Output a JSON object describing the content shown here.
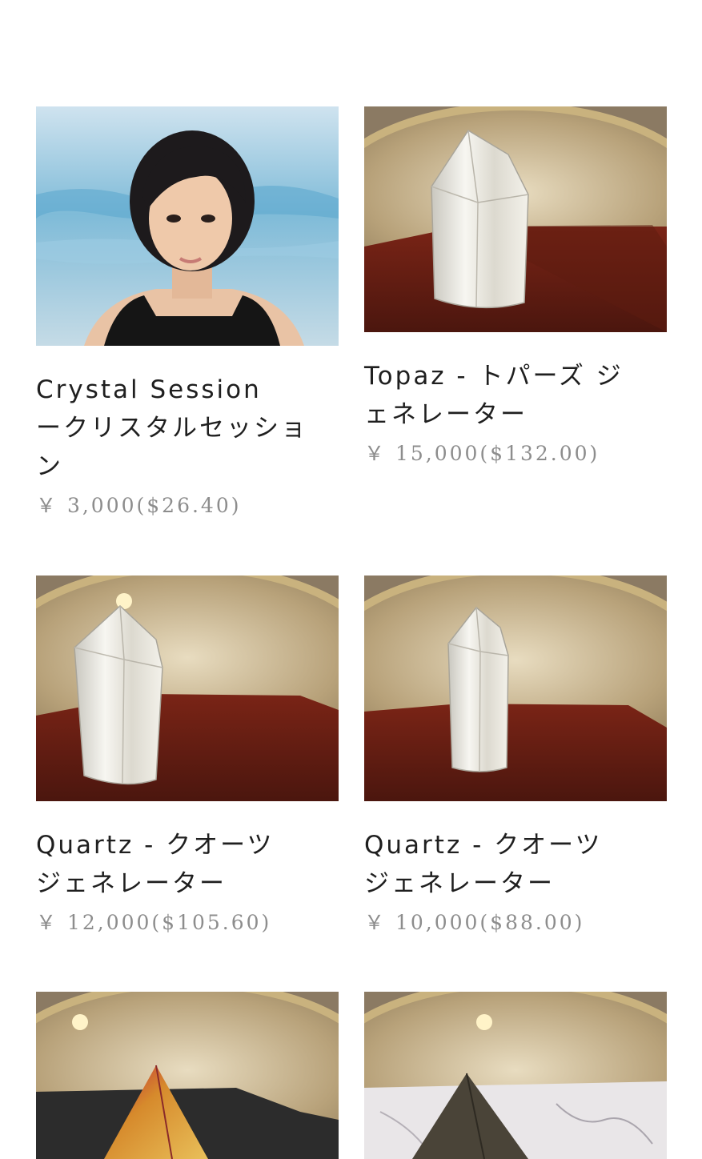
{
  "products": [
    {
      "title_line1": "Crystal Session",
      "title_line2": "ークリスタルセッショ",
      "title_line3": "ン",
      "price": "￥ 3,000($26.40)",
      "image": "portrait-photo"
    },
    {
      "title_line1": "Topaz - トパーズ ジ",
      "title_line2": "ェネレーター",
      "price": "￥ 15,000($132.00)",
      "image": "crystal-point-on-tray-photo"
    },
    {
      "title_line1": "Quartz - クオーツ",
      "title_line2": "ジェネレーター",
      "price": "￥ 12,000($105.60)",
      "image": "crystal-point-on-tray-photo"
    },
    {
      "title_line1": "Quartz - クオーツ",
      "title_line2": "ジェネレーター",
      "price": "￥ 10,000($88.00)",
      "image": "crystal-point-on-tray-photo"
    },
    {
      "image": "aura-pyramid-on-tray-photo"
    },
    {
      "image": "dark-pyramid-on-marble-photo"
    }
  ]
}
